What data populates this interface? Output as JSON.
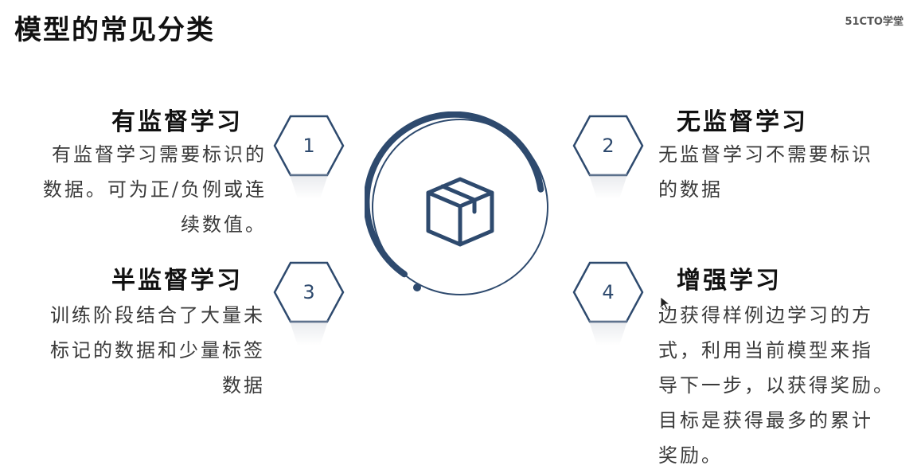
{
  "page": {
    "title": "模型的常见分类",
    "watermark": "51CTO学堂"
  },
  "colors": {
    "accent": "#2e4a6e",
    "hex_border": "#2e4a6e",
    "text": "#3a3a3a"
  },
  "center": {
    "icon": "box-icon"
  },
  "categories": [
    {
      "number": "1",
      "title": "有监督学习",
      "lines": [
        "有监督学习需要标识的",
        "数据。可为正/负例或连",
        "续数值。"
      ]
    },
    {
      "number": "2",
      "title": "无监督学习",
      "lines": [
        "无监督学习不需要标识",
        "的数据"
      ]
    },
    {
      "number": "3",
      "title": "半监督学习",
      "lines": [
        "训练阶段结合了大量未",
        "标记的数据和少量标签",
        "数据"
      ]
    },
    {
      "number": "4",
      "title": "增强学习",
      "lines": [
        "边获得样例边学习的方",
        "式，利用当前模型来指",
        "导下一步，以获得奖励。",
        "目标是获得最多的累计",
        "奖励。"
      ]
    }
  ]
}
